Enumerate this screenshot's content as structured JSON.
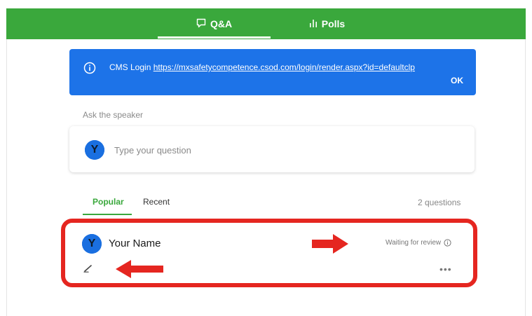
{
  "tabs": {
    "qa_label": "Q&A",
    "polls_label": "Polls"
  },
  "banner": {
    "prefix": "CMS Login",
    "link": "https://mxsafetycompetence.csod.com/login/render.aspx?id=defaultclp",
    "ok_label": "OK"
  },
  "ask": {
    "label": "Ask the speaker",
    "placeholder": "Type your question",
    "avatar_letter": "Y"
  },
  "sort": {
    "popular": "Popular",
    "recent": "Recent",
    "count": "2 questions"
  },
  "question": {
    "avatar_letter": "Y",
    "author": "Your Name",
    "status": "Waiting for review",
    "more": "•••"
  },
  "colors": {
    "topbar": "#3aa83c",
    "banner": "#1d73e8",
    "highlight": "#e52620",
    "avatar": "#1a6fe0"
  }
}
